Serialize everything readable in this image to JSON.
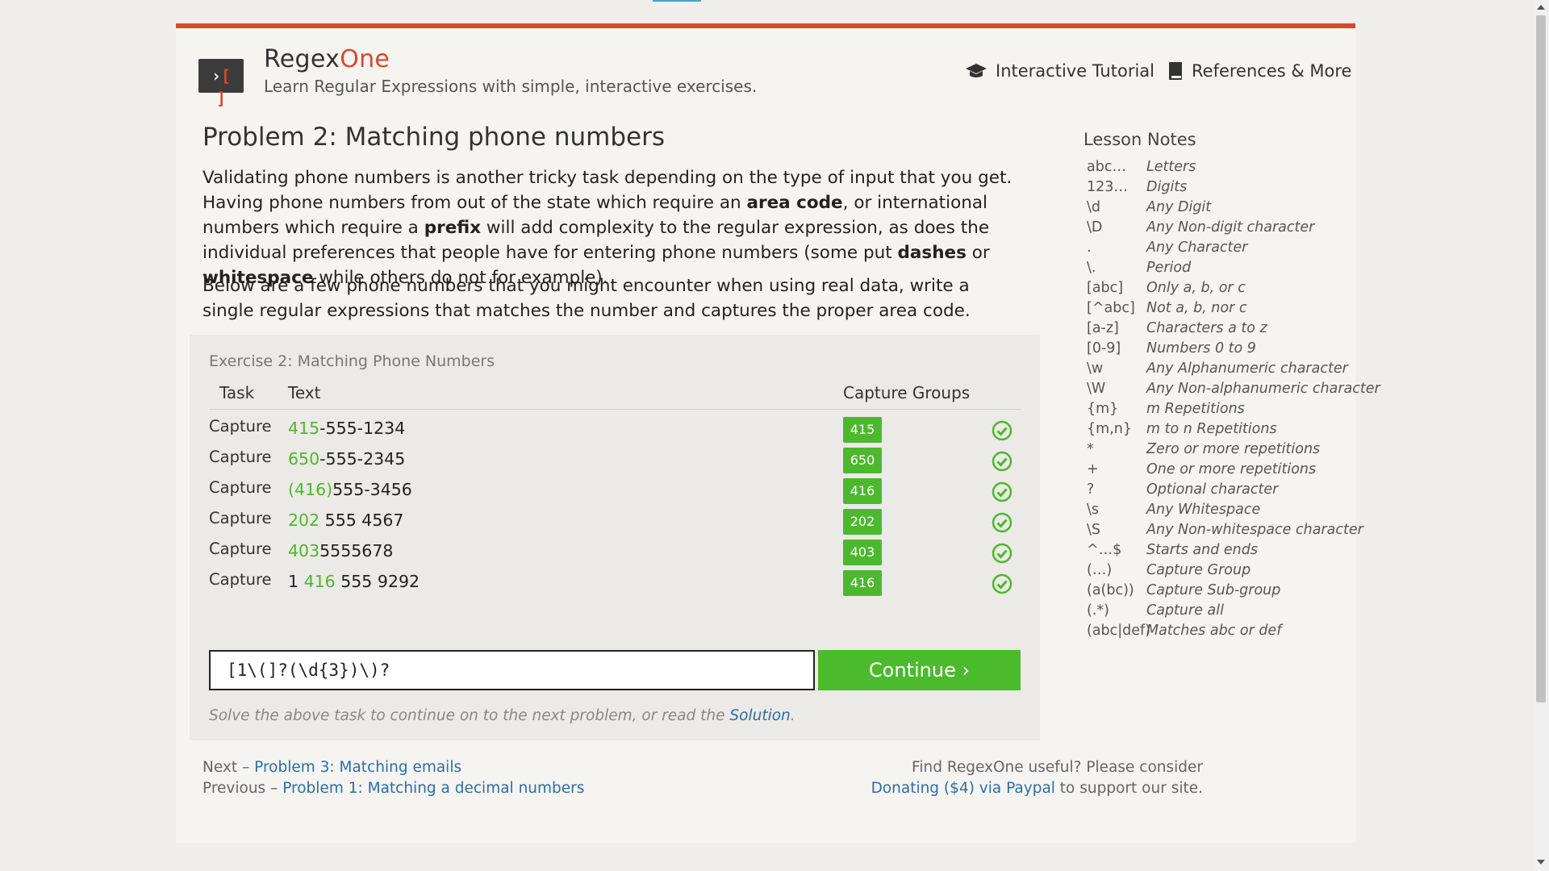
{
  "header": {
    "brand_left": "Regex",
    "brand_right": "One",
    "tagline": "Learn Regular Expressions with simple, interactive exercises.",
    "nav": [
      {
        "label": "Interactive Tutorial",
        "icon": "graduation-cap-icon"
      },
      {
        "label": "References & More",
        "icon": "book-icon"
      }
    ]
  },
  "problem": {
    "title": "Problem 2: Matching phone numbers",
    "para1": [
      {
        "t": "Validating phone numbers is another tricky task depending on the type of input that you get. Having phone numbers from out of the state which require an ",
        "b": false
      },
      {
        "t": "area code",
        "b": true
      },
      {
        "t": ", or international numbers which require a ",
        "b": false
      },
      {
        "t": "prefix",
        "b": true
      },
      {
        "t": " will add complexity to the regular expression, as does the individual preferences that people have for entering phone numbers (some put ",
        "b": false
      },
      {
        "t": "dashes",
        "b": true
      },
      {
        "t": " or ",
        "b": false
      },
      {
        "t": "whitespace",
        "b": true
      },
      {
        "t": " while others do not for example).",
        "b": false
      }
    ],
    "para2": "Below are a few phone numbers that you might encounter when using real data, write a single regular expressions that matches the number and captures the proper area code."
  },
  "exercise": {
    "title": "Exercise 2: Matching Phone Numbers",
    "headers": {
      "task": "Task",
      "text": "Text",
      "capture": "Capture Groups"
    },
    "rows": [
      {
        "task": "Capture",
        "parts": [
          {
            "t": "415",
            "hl": true
          },
          {
            "t": "-555-1234",
            "hl": false
          }
        ],
        "group": "415",
        "status": "success"
      },
      {
        "task": "Capture",
        "parts": [
          {
            "t": "650",
            "hl": true
          },
          {
            "t": "-555-2345",
            "hl": false
          }
        ],
        "group": "650",
        "status": "success"
      },
      {
        "task": "Capture",
        "parts": [
          {
            "t": "(416)",
            "hl": true
          },
          {
            "t": "555-3456",
            "hl": false
          }
        ],
        "group": "416",
        "status": "success"
      },
      {
        "task": "Capture",
        "parts": [
          {
            "t": "202",
            "hl": true
          },
          {
            "t": " 555 4567",
            "hl": false
          }
        ],
        "group": "202",
        "status": "success"
      },
      {
        "task": "Capture",
        "parts": [
          {
            "t": "403",
            "hl": true
          },
          {
            "t": "5555678",
            "hl": false
          }
        ],
        "group": "403",
        "status": "success"
      },
      {
        "task": "Capture",
        "parts": [
          {
            "t": "1 ",
            "hl": false
          },
          {
            "t": "416",
            "hl": true
          },
          {
            "t": " 555 9292",
            "hl": false
          }
        ],
        "group": "416",
        "status": "success"
      }
    ],
    "input_value": "[1\\(]?(\\d{3})\\)?",
    "continue_label": "Continue ›",
    "hint_prefix": "Solve the above task to continue on to the next problem, or read the ",
    "hint_link": "Solution",
    "hint_suffix": "."
  },
  "footer": {
    "next_prefix": "Next – ",
    "next_link": "Problem 3: Matching emails",
    "prev_prefix": "Previous – ",
    "prev_link": "Problem 1: Matching a decimal numbers",
    "donate_line1": "Find RegexOne useful? Please consider",
    "donate_link": "Donating ($4) via Paypal",
    "donate_suffix": " to support our site."
  },
  "lesson_notes": {
    "title": "Lesson Notes",
    "items": [
      {
        "k": "abc…",
        "v": "Letters"
      },
      {
        "k": "123…",
        "v": "Digits"
      },
      {
        "k": "\\d",
        "v": "Any Digit"
      },
      {
        "k": "\\D",
        "v": "Any Non-digit character"
      },
      {
        "k": ".",
        "v": "Any Character"
      },
      {
        "k": "\\.",
        "v": "Period"
      },
      {
        "k": "[abc]",
        "v": "Only a, b, or c"
      },
      {
        "k": "[^abc]",
        "v": "Not a, b, nor c"
      },
      {
        "k": "[a-z]",
        "v": "Characters a to z"
      },
      {
        "k": "[0-9]",
        "v": "Numbers 0 to 9"
      },
      {
        "k": "\\w",
        "v": "Any Alphanumeric character"
      },
      {
        "k": "\\W",
        "v": "Any Non-alphanumeric character"
      },
      {
        "k": "{m}",
        "v": "m Repetitions"
      },
      {
        "k": "{m,n}",
        "v": "m to n Repetitions"
      },
      {
        "k": "*",
        "v": "Zero or more repetitions"
      },
      {
        "k": "+",
        "v": "One or more repetitions"
      },
      {
        "k": "?",
        "v": "Optional character"
      },
      {
        "k": "\\s",
        "v": "Any Whitespace"
      },
      {
        "k": "\\S",
        "v": "Any Non-whitespace character"
      },
      {
        "k": "^…$",
        "v": "Starts and ends"
      },
      {
        "k": "(…)",
        "v": "Capture Group"
      },
      {
        "k": "(a(bc))",
        "v": "Capture Sub-group"
      },
      {
        "k": "(.*)",
        "v": "Capture all"
      },
      {
        "k": "(abc|def)",
        "v": "Matches abc or def"
      }
    ]
  },
  "colors": {
    "accent": "#d9482b",
    "match_green": "#4cb82e",
    "link_blue": "#2e6da4"
  }
}
